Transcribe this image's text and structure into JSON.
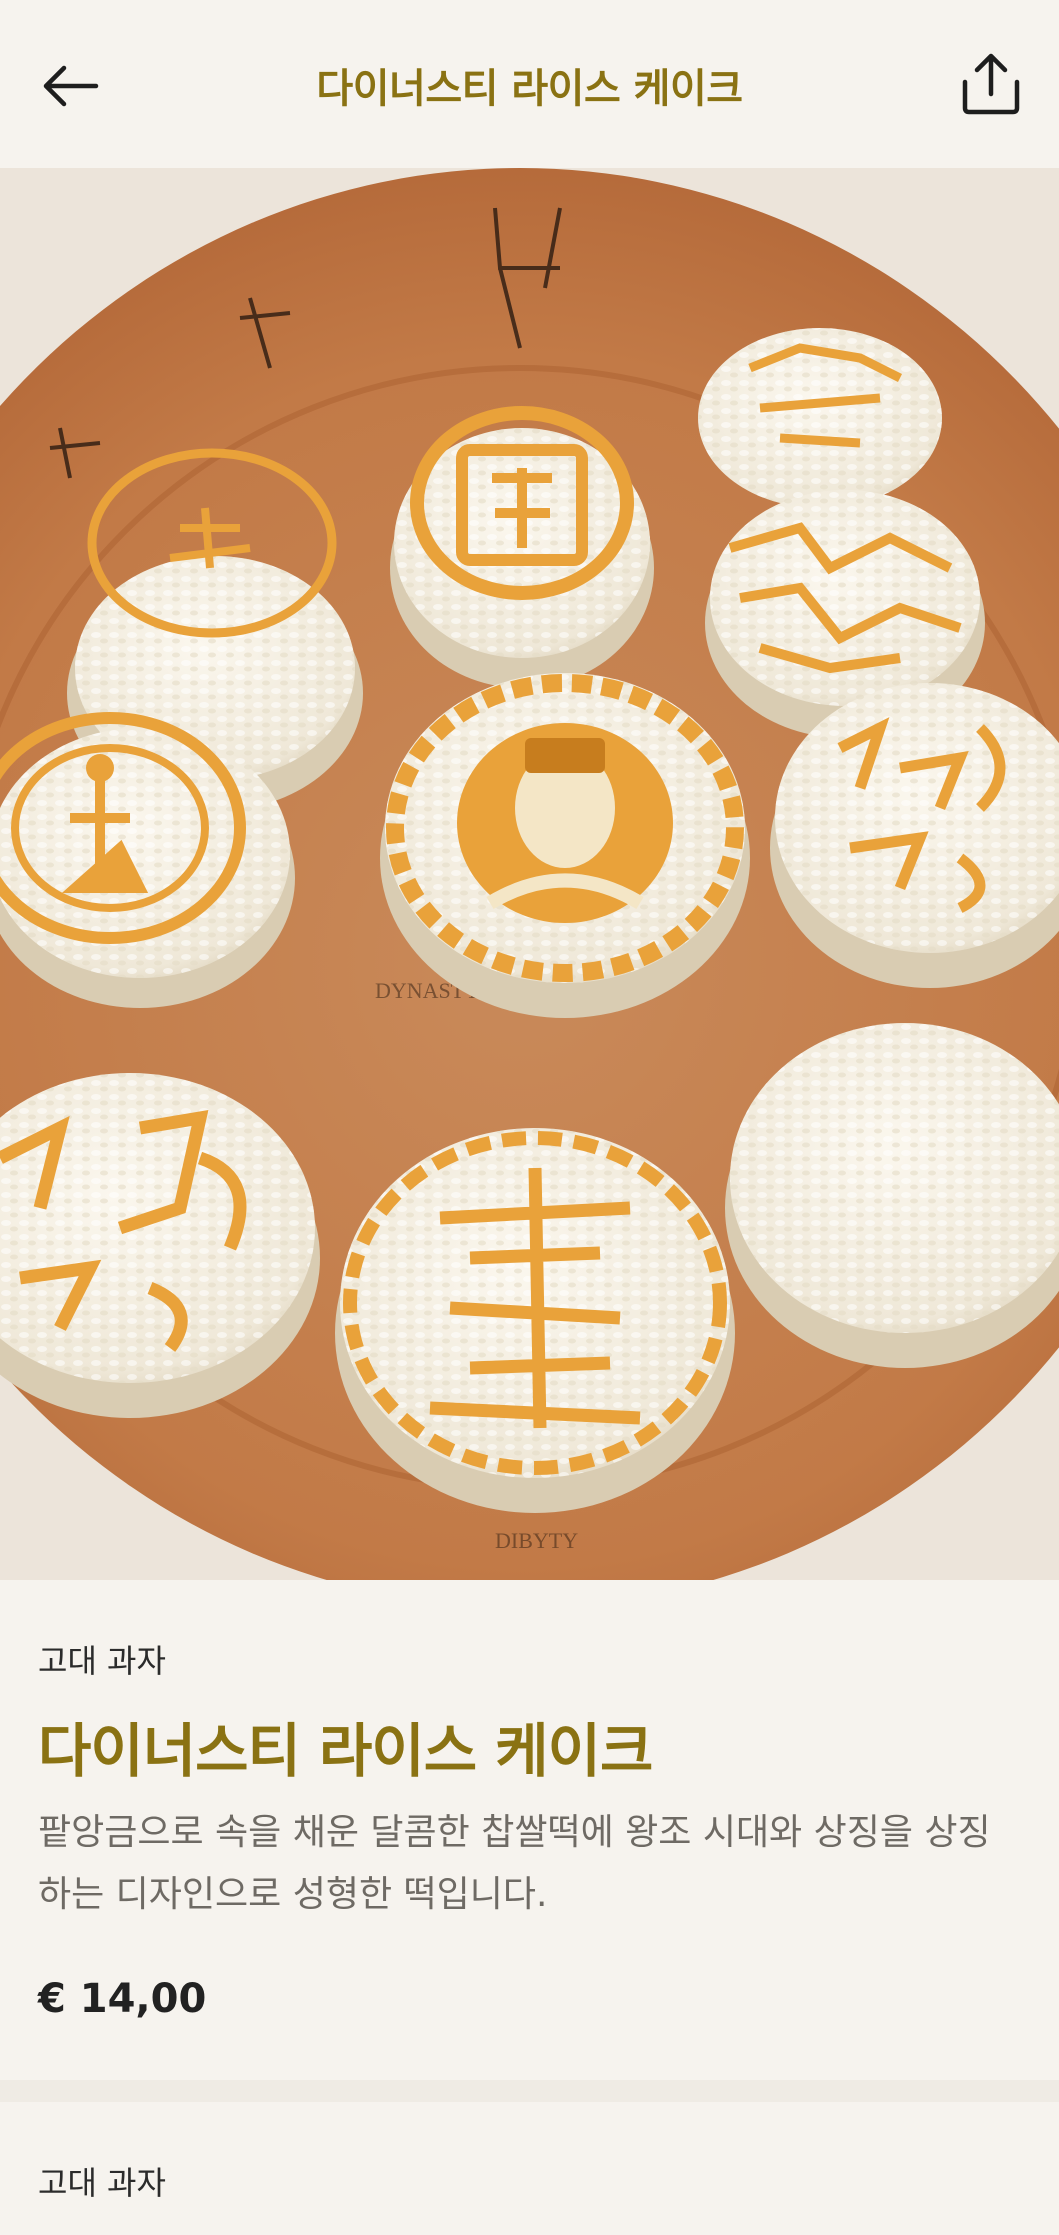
{
  "header": {
    "title": "다이너스티 라이스 케이크",
    "back_icon": "arrow-left-icon",
    "share_icon": "share-icon"
  },
  "hero": {
    "plate_color": "#c8804f",
    "cake_color": "#f4efe3",
    "stamp_color": "#e9a23a"
  },
  "product": {
    "category": "고대 과자",
    "title": "다이너스티 라이스 케이크",
    "description": "팥앙금으로 속을 채운 달콤한 찹쌀떡에 왕조 시대와 상징을 상징하는 디자인으로 성형한 떡입니다.",
    "price": "€ 14,00"
  },
  "next_section": {
    "category": "고대 과자"
  },
  "colors": {
    "accent": "#8a7213",
    "background": "#f6f3ee"
  }
}
